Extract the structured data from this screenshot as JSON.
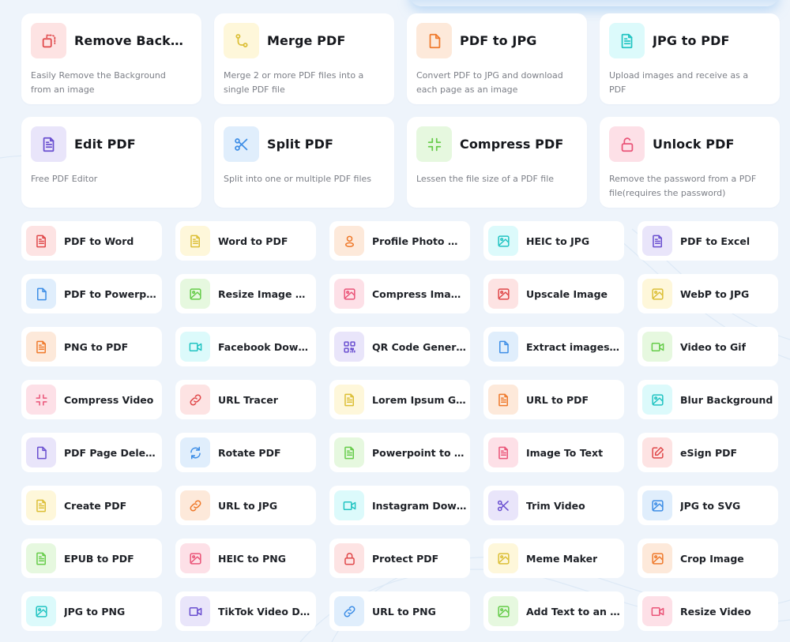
{
  "colors": {
    "red": {
      "fg": "#e0484a",
      "bg": "#fde3e3"
    },
    "yellow": {
      "fg": "#dcbf37",
      "bg": "#fef7da"
    },
    "orange": {
      "fg": "#ef7a2c",
      "bg": "#fde9da"
    },
    "cyan": {
      "fg": "#22c4c2",
      "bg": "#dcfafb"
    },
    "purple": {
      "fg": "#6a4fd0",
      "bg": "#e9e5fa"
    },
    "blue": {
      "fg": "#3e8ee6",
      "bg": "#e0eefc"
    },
    "green": {
      "fg": "#66cc4a",
      "bg": "#e6f8df"
    },
    "pink": {
      "fg": "#ea5478",
      "bg": "#fde0e7"
    }
  },
  "featured_tools": [
    {
      "title": "Remove Backgr...",
      "description": "Easily Remove the Background from an image",
      "icon": "remove-background-icon",
      "color": "red"
    },
    {
      "title": "Merge PDF",
      "description": "Merge 2 or more PDF files into a single PDF file",
      "icon": "merge-icon",
      "color": "yellow"
    },
    {
      "title": "PDF to JPG",
      "description": "Convert PDF to JPG and download each page as an image",
      "icon": "file-icon",
      "color": "orange"
    },
    {
      "title": "JPG to PDF",
      "description": "Upload images and receive as a PDF",
      "icon": "document-icon",
      "color": "cyan"
    },
    {
      "title": "Edit PDF",
      "description": "Free PDF Editor",
      "icon": "document-icon",
      "color": "purple"
    },
    {
      "title": "Split PDF",
      "description": "Split into one or multiple PDF files",
      "icon": "scissors-icon",
      "color": "blue"
    },
    {
      "title": "Compress PDF",
      "description": "Lessen the file size of a PDF file",
      "icon": "compress-icon",
      "color": "green"
    },
    {
      "title": "Unlock PDF",
      "description": "Remove the password from a PDF file(requires the password)",
      "icon": "unlock-icon",
      "color": "pink"
    }
  ],
  "tools": [
    {
      "label": "PDF to Word",
      "icon": "document-icon",
      "color": "red"
    },
    {
      "label": "Word to PDF",
      "icon": "document-icon",
      "color": "yellow"
    },
    {
      "label": "Profile Photo Ma...",
      "icon": "user-icon",
      "color": "orange"
    },
    {
      "label": "HEIC to JPG",
      "icon": "image-icon",
      "color": "cyan"
    },
    {
      "label": "PDF to Excel",
      "icon": "document-icon",
      "color": "purple"
    },
    {
      "label": "PDF to Powerpoint",
      "icon": "file-icon",
      "color": "blue"
    },
    {
      "label": "Resize Image Di...",
      "icon": "image-icon",
      "color": "green"
    },
    {
      "label": "Compress Imag...",
      "icon": "image-icon",
      "color": "pink"
    },
    {
      "label": "Upscale Image",
      "icon": "image-icon",
      "color": "red"
    },
    {
      "label": "WebP to JPG",
      "icon": "image-icon",
      "color": "yellow"
    },
    {
      "label": "PNG to PDF",
      "icon": "document-icon",
      "color": "orange"
    },
    {
      "label": "Facebook Downl...",
      "icon": "video-icon",
      "color": "cyan"
    },
    {
      "label": "QR Code Genera...",
      "icon": "qr-code-icon",
      "color": "purple"
    },
    {
      "label": "Extract images P...",
      "icon": "file-icon",
      "color": "blue"
    },
    {
      "label": "Video to Gif",
      "icon": "video-icon",
      "color": "green"
    },
    {
      "label": "Compress Video",
      "icon": "compress-icon",
      "color": "pink"
    },
    {
      "label": "URL Tracer",
      "icon": "link-icon",
      "color": "red"
    },
    {
      "label": "Lorem Ipsum Ge...",
      "icon": "document-icon",
      "color": "yellow"
    },
    {
      "label": "URL to PDF",
      "icon": "document-icon",
      "color": "orange"
    },
    {
      "label": "Blur Background",
      "icon": "image-icon",
      "color": "cyan"
    },
    {
      "label": "PDF Page Deleter",
      "icon": "file-icon",
      "color": "purple"
    },
    {
      "label": "Rotate PDF",
      "icon": "rotate-icon",
      "color": "blue"
    },
    {
      "label": "Powerpoint to PDF",
      "icon": "document-icon",
      "color": "green"
    },
    {
      "label": "Image To Text",
      "icon": "document-icon",
      "color": "pink"
    },
    {
      "label": "eSign PDF",
      "icon": "edit-icon",
      "color": "red"
    },
    {
      "label": "Create PDF",
      "icon": "document-icon",
      "color": "yellow"
    },
    {
      "label": "URL to JPG",
      "icon": "link-icon",
      "color": "orange"
    },
    {
      "label": "Instagram Down...",
      "icon": "video-icon",
      "color": "cyan"
    },
    {
      "label": "Trim Video",
      "icon": "scissors-icon",
      "color": "purple"
    },
    {
      "label": "JPG to SVG",
      "icon": "image-icon",
      "color": "blue"
    },
    {
      "label": "EPUB to PDF",
      "icon": "document-icon",
      "color": "green"
    },
    {
      "label": "HEIC to PNG",
      "icon": "image-icon",
      "color": "pink"
    },
    {
      "label": "Protect PDF",
      "icon": "lock-icon",
      "color": "red"
    },
    {
      "label": "Meme Maker",
      "icon": "image-icon",
      "color": "yellow"
    },
    {
      "label": "Crop Image",
      "icon": "image-icon",
      "color": "orange"
    },
    {
      "label": "JPG to PNG",
      "icon": "image-icon",
      "color": "cyan"
    },
    {
      "label": "TikTok Video Do...",
      "icon": "video-icon",
      "color": "purple"
    },
    {
      "label": "URL to PNG",
      "icon": "link-icon",
      "color": "blue"
    },
    {
      "label": "Add Text to an I...",
      "icon": "image-icon",
      "color": "green"
    },
    {
      "label": "Resize Video",
      "icon": "video-icon",
      "color": "pink"
    }
  ]
}
